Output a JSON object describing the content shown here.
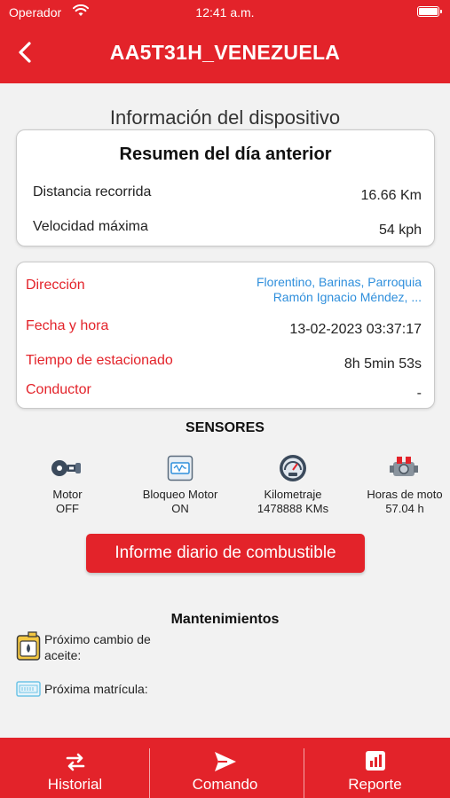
{
  "status_bar": {
    "carrier": "Operador",
    "time": "12:41 a.m."
  },
  "header": {
    "title": "AA5T31H_VENEZUELA"
  },
  "section_title": "Información del dispositivo",
  "summary": {
    "title": "Resumen del día anterior",
    "distance_label": "Distancia recorrida",
    "distance_value": "16.66 Km",
    "speed_label": "Velocidad máxima",
    "speed_value": "54 kph"
  },
  "details": {
    "address_label": "Dirección",
    "address_line1": "Florentino, Barinas, Parroquia",
    "address_line2": "Ramón Ignacio Méndez, ...",
    "datetime_label": "Fecha y hora",
    "datetime_value": "13-02-2023 03:37:17",
    "parked_label": "Tiempo de estacionado",
    "parked_value": "8h 5min 53s",
    "driver_label": "Conductor",
    "driver_value": "-"
  },
  "sensors": {
    "title": "SENSORES",
    "items": [
      {
        "label": "Motor",
        "value": "OFF",
        "icon": "engine-key-icon"
      },
      {
        "label": "Bloqueo Motor",
        "value": "ON",
        "icon": "engine-lock-icon"
      },
      {
        "label": "Kilometraje",
        "value": "1478888 KMs",
        "icon": "odometer-icon"
      },
      {
        "label": "Horas de moto",
        "value": "57.04 h",
        "icon": "engine-hours-icon"
      }
    ]
  },
  "fuel_button": {
    "label": "Informe diario de combustible"
  },
  "maintenance": {
    "title": "Mantenimientos",
    "oil_change_label": "Próximo cambio de aceite:",
    "registration_label": "Próxima matrícula:"
  },
  "tabbar": {
    "tabs": [
      {
        "label": "Historial",
        "icon": "history-arrows-icon"
      },
      {
        "label": "Comando",
        "icon": "send-icon"
      },
      {
        "label": "Reporte",
        "icon": "report-chart-icon"
      }
    ]
  },
  "colors": {
    "brand_red": "#e3232a",
    "link_blue": "#2f8fdc"
  }
}
